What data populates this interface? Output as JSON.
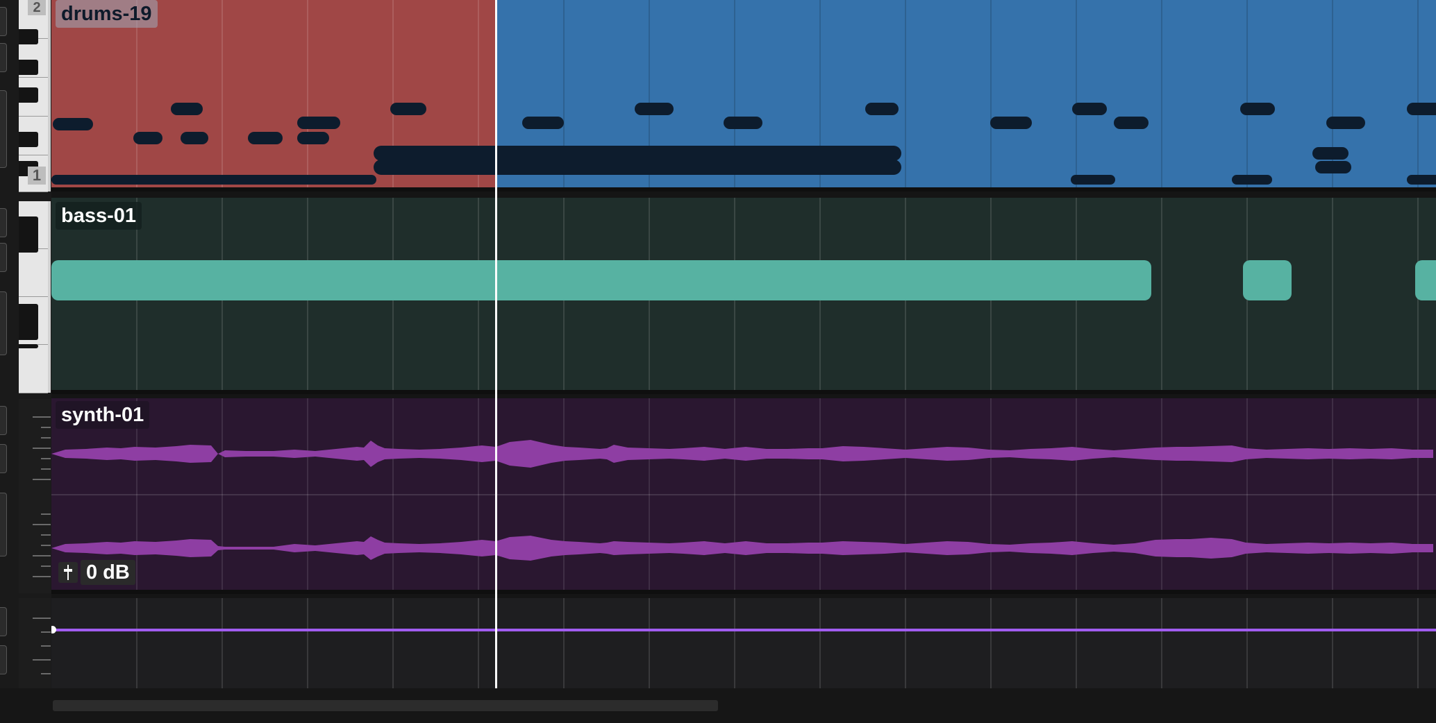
{
  "tracks": {
    "drums": {
      "clip_name": "drums-19",
      "lane_number_top": "2",
      "lane_number_bottom": "1",
      "colors": {
        "selected_region": "#a04746",
        "clip": "#3572ab",
        "notes": "#0d1c2d"
      }
    },
    "bass": {
      "clip_name": "bass-01",
      "colors": {
        "clip": "#1f2e2b",
        "notes": "#57b2a2"
      }
    },
    "synth": {
      "clip_name": "synth-01",
      "gain_icon": "fader-icon",
      "gain_label": "0 dB",
      "colors": {
        "clip": "#2a1730",
        "waveform": "#8e3ea3"
      }
    },
    "automation": {
      "colors": {
        "line": "#a15df0",
        "background": "#1e1e20"
      }
    }
  },
  "playhead": {
    "color": "#ffffff"
  }
}
